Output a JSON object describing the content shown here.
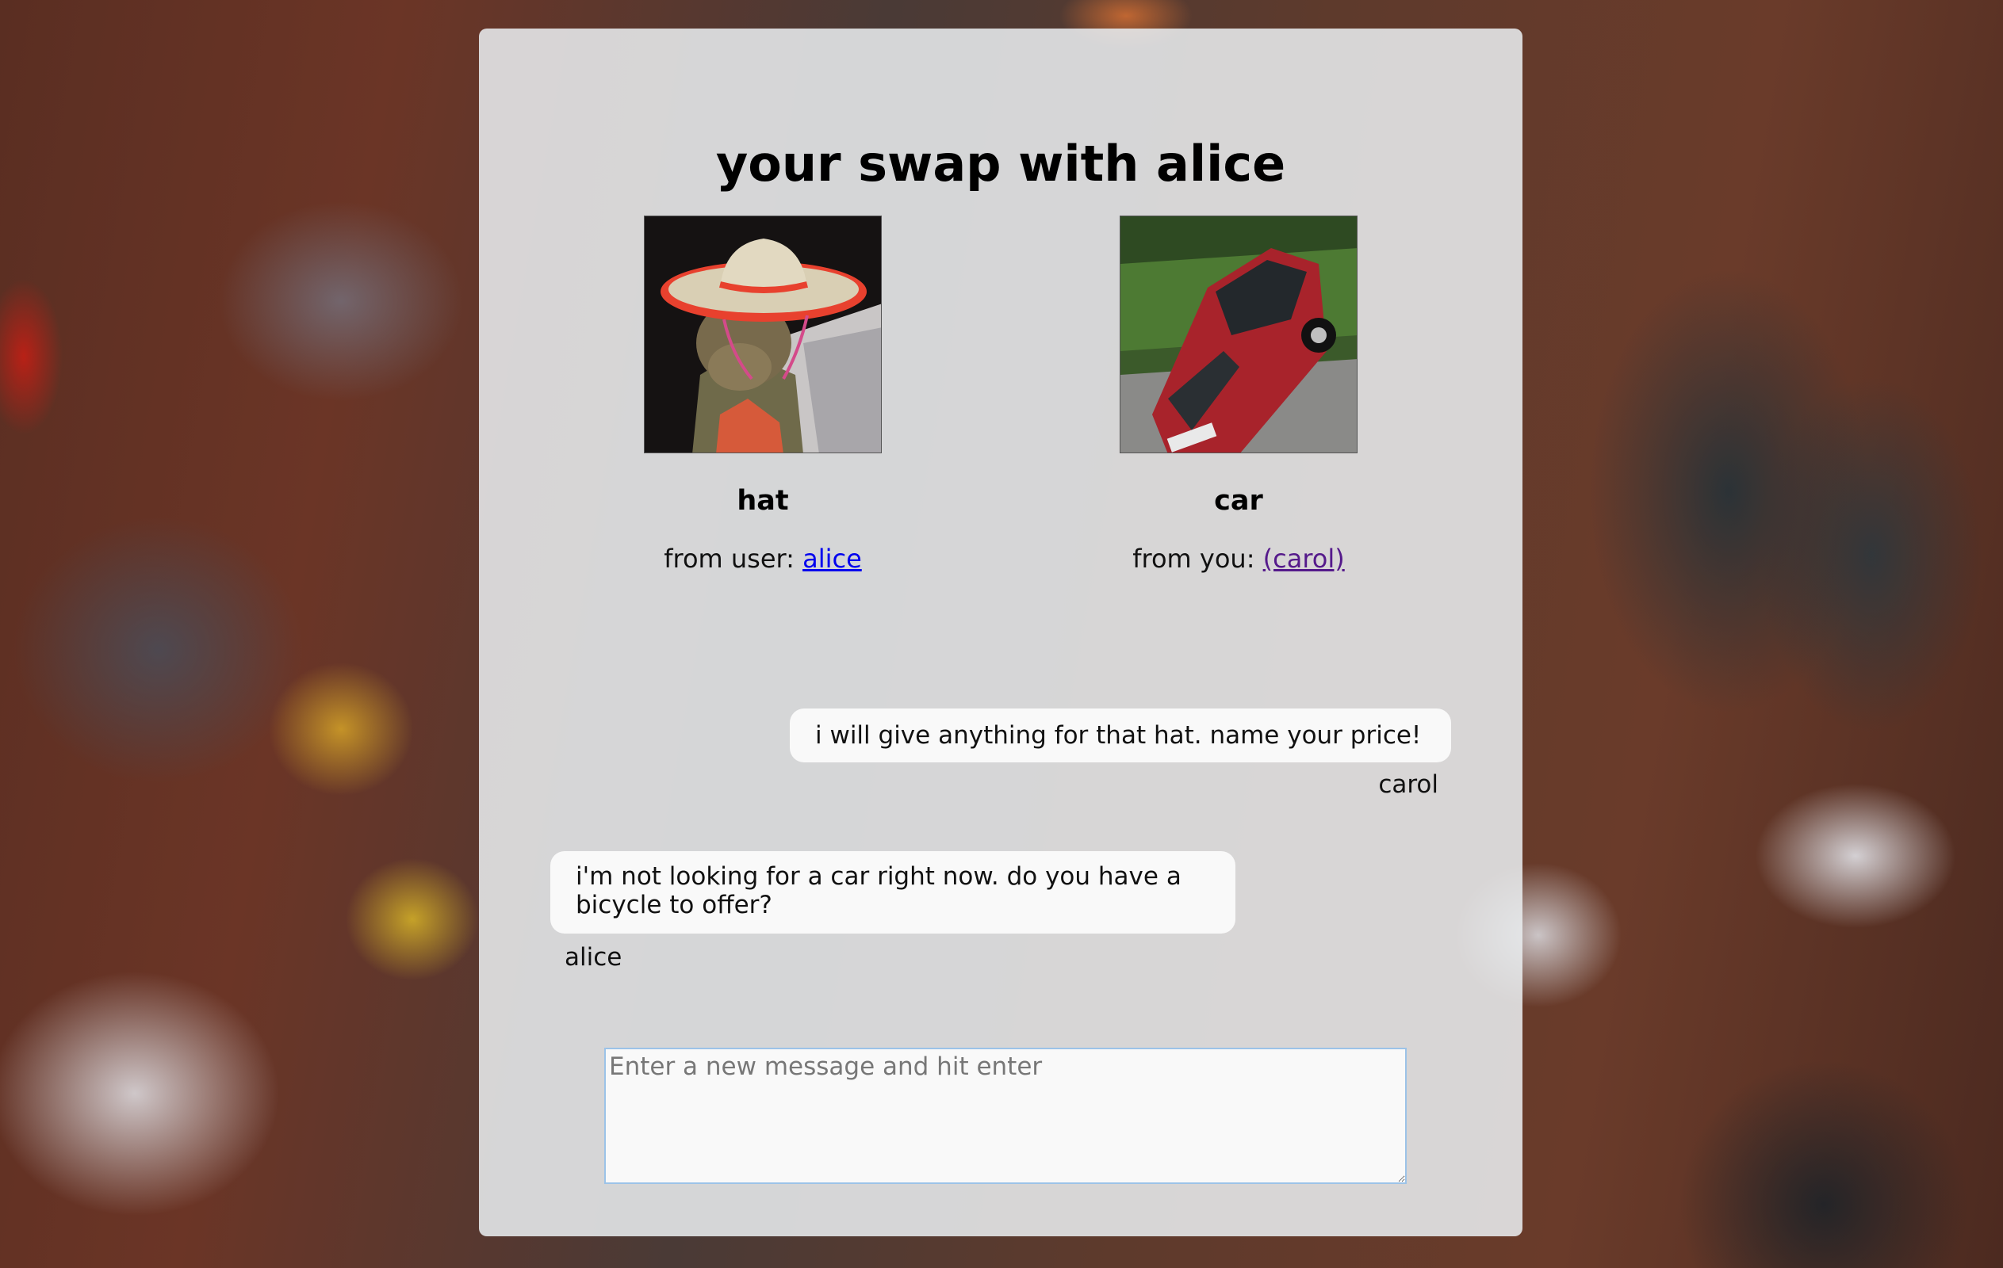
{
  "page": {
    "title": "your swap with alice"
  },
  "items": [
    {
      "name": "hat",
      "owner_prefix": "from user: ",
      "owner_link": "alice",
      "image": "sombrero-lizard-photo"
    },
    {
      "name": "car",
      "owner_prefix": "from you: ",
      "owner_link": "(carol)",
      "image": "red-car-photo"
    }
  ],
  "messages": [
    {
      "text": "i will give anything for that hat. name your price!",
      "author": "carol",
      "align": "right"
    },
    {
      "text": "i'm not looking for a car right now. do you have a bicycle to offer?",
      "author": "alice",
      "align": "left"
    }
  ],
  "composer": {
    "placeholder": "Enter a new message and hit enter",
    "value": ""
  },
  "colors": {
    "link": "#0000ee",
    "visited_link": "#551a8b",
    "composer_focus_border": "#9cc3e8"
  }
}
